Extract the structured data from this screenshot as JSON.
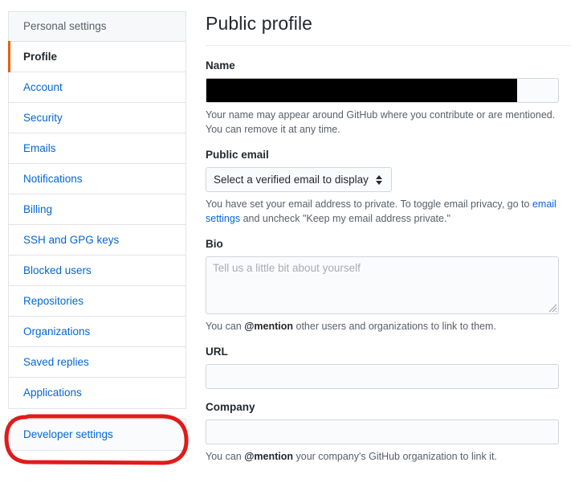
{
  "sidebar": {
    "header": "Personal settings",
    "items": [
      {
        "label": "Profile",
        "active": true
      },
      {
        "label": "Account",
        "active": false
      },
      {
        "label": "Security",
        "active": false
      },
      {
        "label": "Emails",
        "active": false
      },
      {
        "label": "Notifications",
        "active": false
      },
      {
        "label": "Billing",
        "active": false
      },
      {
        "label": "SSH and GPG keys",
        "active": false
      },
      {
        "label": "Blocked users",
        "active": false
      },
      {
        "label": "Repositories",
        "active": false
      },
      {
        "label": "Organizations",
        "active": false
      },
      {
        "label": "Saved replies",
        "active": false
      },
      {
        "label": "Applications",
        "active": false
      }
    ],
    "developer_settings": "Developer settings",
    "active_accent_color": "#e36209",
    "link_color": "#0366d6"
  },
  "annotation": {
    "shape": "ellipse-highlight",
    "target": "Developer settings",
    "color": "#e01b1b"
  },
  "main": {
    "title": "Public profile",
    "name": {
      "label": "Name",
      "value": "",
      "placeholder": "",
      "redacted": true,
      "help": "Your name may appear around GitHub where you contribute or are mentioned. You can remove it at any time."
    },
    "public_email": {
      "label": "Public email",
      "selected_option": "Select a verified email to display",
      "options": [
        "Select a verified email to display"
      ],
      "help_before_link": "You have set your email address to private. To toggle email privacy, go to ",
      "help_link": "email settings",
      "help_after_link": " and uncheck \"Keep my email address private.\""
    },
    "bio": {
      "label": "Bio",
      "value": "",
      "placeholder": "Tell us a little bit about yourself",
      "help_before": "You can ",
      "help_mention": "@mention",
      "help_after": " other users and organizations to link to them."
    },
    "url": {
      "label": "URL",
      "value": "",
      "placeholder": ""
    },
    "company": {
      "label": "Company",
      "value": "",
      "placeholder": "",
      "help_before": "You can ",
      "help_mention": "@mention",
      "help_after": " your company's GitHub organization to link it."
    }
  }
}
